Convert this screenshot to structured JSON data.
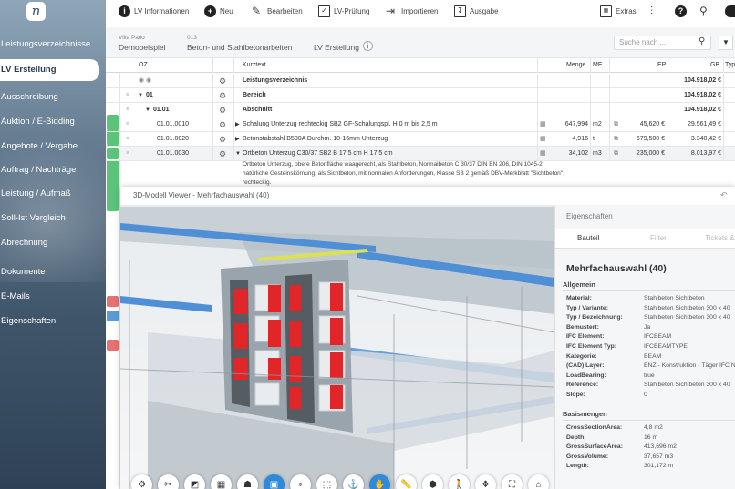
{
  "sidebar": {
    "logo_text": "n",
    "items": [
      {
        "label": "Leistungsverzeichnisse",
        "active": false
      },
      {
        "label": "LV Erstellung",
        "active": true
      },
      {
        "label": "Ausschreibung",
        "active": false
      },
      {
        "label": "Auktion / E-Bidding",
        "active": false
      },
      {
        "label": "Angebote / Vergabe",
        "active": false
      },
      {
        "label": "Auftrag / Nachträge",
        "active": false
      },
      {
        "label": "Leistung / Aufmaß",
        "active": false
      },
      {
        "label": "Soll-Ist Vergleich",
        "active": false
      },
      {
        "label": "Abrechnung",
        "active": false
      },
      {
        "label": "Dokumente",
        "active": false
      },
      {
        "label": "E-Mails",
        "active": false
      },
      {
        "label": "Eigenschaften",
        "active": false
      }
    ]
  },
  "toolbar": {
    "items": [
      {
        "label": "LV Informationen",
        "icon": "info-icon"
      },
      {
        "label": "Neu",
        "icon": "plus-icon"
      },
      {
        "label": "Bearbeiten",
        "icon": "pencil-icon"
      },
      {
        "label": "LV-Prüfung",
        "icon": "check-box-icon"
      },
      {
        "label": "Importieren",
        "icon": "import-icon"
      },
      {
        "label": "Ausgabe",
        "icon": "export-icon"
      }
    ],
    "extras_label": "Extras"
  },
  "breadcrumb": {
    "project_small": "Villa Patio",
    "project": "Demobeispiel",
    "lot_small": "013",
    "lot": "Beton- und Stahlbetonarbeiten",
    "current": "LV Erstellung"
  },
  "search": {
    "placeholder": "Suche nach ..."
  },
  "table": {
    "headers": {
      "oz": "OZ",
      "kurztext": "Kurztext",
      "menge": "Menge",
      "me": "ME",
      "ep": "EP",
      "gb": "GB",
      "typ": "Typ"
    },
    "rows": [
      {
        "oz": "",
        "kurztext": "Leistungsverzeichnis",
        "menge": "",
        "me": "",
        "ep": "",
        "gb": "104.918,02 €",
        "bold": true,
        "status": ""
      },
      {
        "oz": "01",
        "kurztext": "Bereich",
        "menge": "",
        "me": "",
        "ep": "",
        "gb": "104.918,02 €",
        "bold": true,
        "status": ""
      },
      {
        "oz": "01.01",
        "kurztext": "Abschnitt",
        "menge": "",
        "me": "",
        "ep": "",
        "gb": "104.918,02 €",
        "bold": true,
        "status": ""
      },
      {
        "oz": "01.01.0010",
        "kurztext": "Schalung Unterzug rechteckig SB2 GF-Schalungspl. H 0 m bis 2,5 m",
        "menge": "647,994",
        "me": "m2",
        "ep": "45,620 €",
        "gb": "29.561,49 €",
        "bold": false,
        "status": "#5cc47a"
      },
      {
        "oz": "01.01.0020",
        "kurztext": "Betonstabstahl B500A Durchm. 10-16mm Unterzug",
        "menge": "4,916",
        "me": "t",
        "ep": "679,500 €",
        "gb": "3.340,42 €",
        "bold": false,
        "status": "#5cc47a"
      },
      {
        "oz": "01.01.0030",
        "kurztext": "Ortbeton Unterzug C30/37 SB2 B 17,5 cm H 17,5 cm",
        "menge": "34,102",
        "me": "m3",
        "ep": "235,000 €",
        "gb": "8.013,97 €",
        "bold": false,
        "status": "#5cc47a"
      }
    ],
    "description": "Ortbeton Unterzug, obere Betonfläche waagerecht, als Stahlbeton, Normalbeton C 30/37 DIN EN 206, DIN 1045-2, natürliche Gesteinskörnung, als Sichtbeton, mit normalen Anforderungen, Klasse SB 2 gemäß DBV-Merkblatt \"Sichtbeton\", rechteckig."
  },
  "status_strip": [
    "#5cc47a",
    "#5cc47a",
    "#5cc47a",
    "#5cc47a",
    "#e57373",
    "#5b9bd5",
    "#e57373"
  ],
  "viewer": {
    "title": "3D-Modell Viewer - Mehrfachauswahl (40)",
    "props_title": "Eigenschaften",
    "tabs": [
      "Bauteil",
      "Filter",
      "Tickets &"
    ],
    "selection": "Mehrfachauswahl (40)",
    "general_header": "Allgemein",
    "general": [
      {
        "k": "Material:",
        "v": "Stahlbeton Sichtbeton"
      },
      {
        "k": "Typ / Variante:",
        "v": "Stahlbeton Sichtbeton 300 x 40"
      },
      {
        "k": "Typ / Bezeichnung:",
        "v": "Stahlbeton Sichtbeton 300 x 40"
      },
      {
        "k": "Bemustert:",
        "v": "Ja"
      },
      {
        "k": "IFC Element:",
        "v": "IFCBEAM"
      },
      {
        "k": "IFC Element Typ:",
        "v": "IFCBEAMTYPE"
      },
      {
        "k": "Kategorie:",
        "v": "BEAM"
      },
      {
        "k": "(CAD) Layer:",
        "v": "ENZ - Konstruktion - Täger IFC N"
      },
      {
        "k": "LoadBearing:",
        "v": "true"
      },
      {
        "k": "Reference:",
        "v": "Stahlbeton Sichtbeton 300 x 40"
      },
      {
        "k": "Slope:",
        "v": "0"
      }
    ],
    "base_header": "Basismengen",
    "base": [
      {
        "k": "CrossSectionArea:",
        "v": "4,8 m2"
      },
      {
        "k": "Depth:",
        "v": "16 m"
      },
      {
        "k": "GrossSurfaceArea:",
        "v": "413,696 m2"
      },
      {
        "k": "GrossVolume:",
        "v": "37,657 m3"
      },
      {
        "k": "Length:",
        "v": "301,172 m"
      }
    ],
    "tools": [
      {
        "name": "settings-tool-icon",
        "glyph": "⚙",
        "on": false
      },
      {
        "name": "wrench-tool-icon",
        "glyph": "✂",
        "on": false
      },
      {
        "name": "half-cube-tool-icon",
        "glyph": "◩",
        "on": false
      },
      {
        "name": "grid-tool-icon",
        "glyph": "▦",
        "on": false
      },
      {
        "name": "hierarchy-tool-icon",
        "glyph": "☗",
        "on": false
      },
      {
        "name": "save-view-tool-icon",
        "glyph": "▣",
        "on": true
      },
      {
        "name": "target-tool-icon",
        "glyph": "⌖",
        "on": false
      },
      {
        "name": "select-box-tool-icon",
        "glyph": "⬚",
        "on": false
      },
      {
        "name": "anchor-tool-icon",
        "glyph": "⚓",
        "on": false
      },
      {
        "name": "hand-tool-icon",
        "glyph": "✋",
        "on": true
      },
      {
        "name": "measure-tool-icon",
        "glyph": "📏",
        "on": false
      },
      {
        "name": "cube-tool-icon",
        "glyph": "⬢",
        "on": false
      },
      {
        "name": "person-tool-icon",
        "glyph": "🚶",
        "on": false
      },
      {
        "name": "explode-tool-icon",
        "glyph": "❖",
        "on": false
      },
      {
        "name": "fit-tool-icon",
        "glyph": "⛶",
        "on": false
      },
      {
        "name": "home-tool-icon",
        "glyph": "⌂",
        "on": false
      }
    ]
  }
}
